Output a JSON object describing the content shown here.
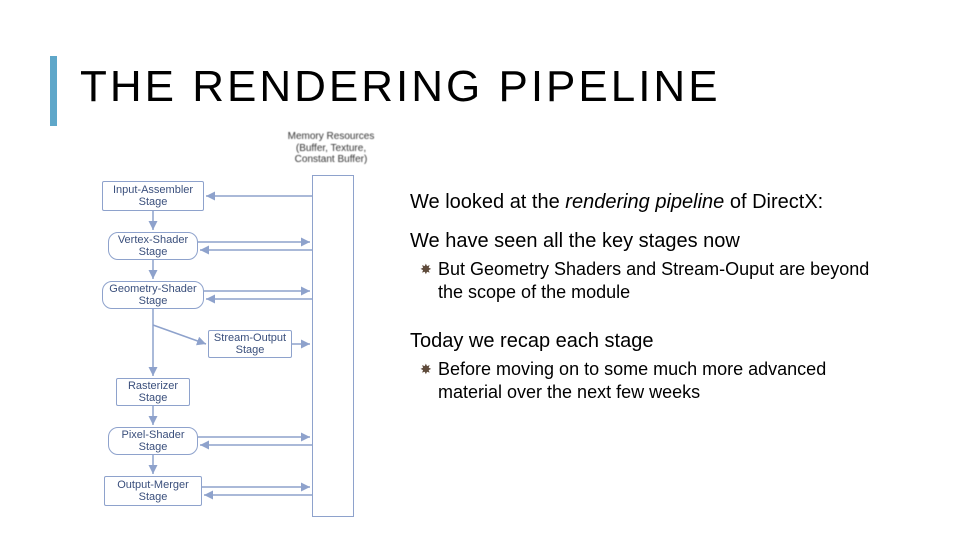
{
  "title": "THE RENDERING PIPELINE",
  "diagram": {
    "mem_label_l1": "Memory Resources",
    "mem_label_l2": "(Buffer, Texture,",
    "mem_label_l3": "Constant Buffer)",
    "stages": {
      "ia_l1": "Input-Assembler",
      "ia_l2": "Stage",
      "vs_l1": "Vertex-Shader",
      "vs_l2": "Stage",
      "gs_l1": "Geometry-Shader",
      "gs_l2": "Stage",
      "so_l1": "Stream-Output",
      "so_l2": "Stage",
      "rs_l1": "Rasterizer",
      "rs_l2": "Stage",
      "ps_l1": "Pixel-Shader",
      "ps_l2": "Stage",
      "om_l1": "Output-Merger",
      "om_l2": "Stage"
    }
  },
  "text": {
    "p1a": "We looked at the ",
    "p1b_italic": "rendering pipeline",
    "p1c": " of DirectX:",
    "p2": "We have seen all the key stages now",
    "sub1": "But Geometry Shaders and Stream-Ouput are beyond the scope of the module",
    "p3": "Today we recap each stage",
    "sub2": "Before moving on to some much more advanced material over the next few weeks"
  }
}
